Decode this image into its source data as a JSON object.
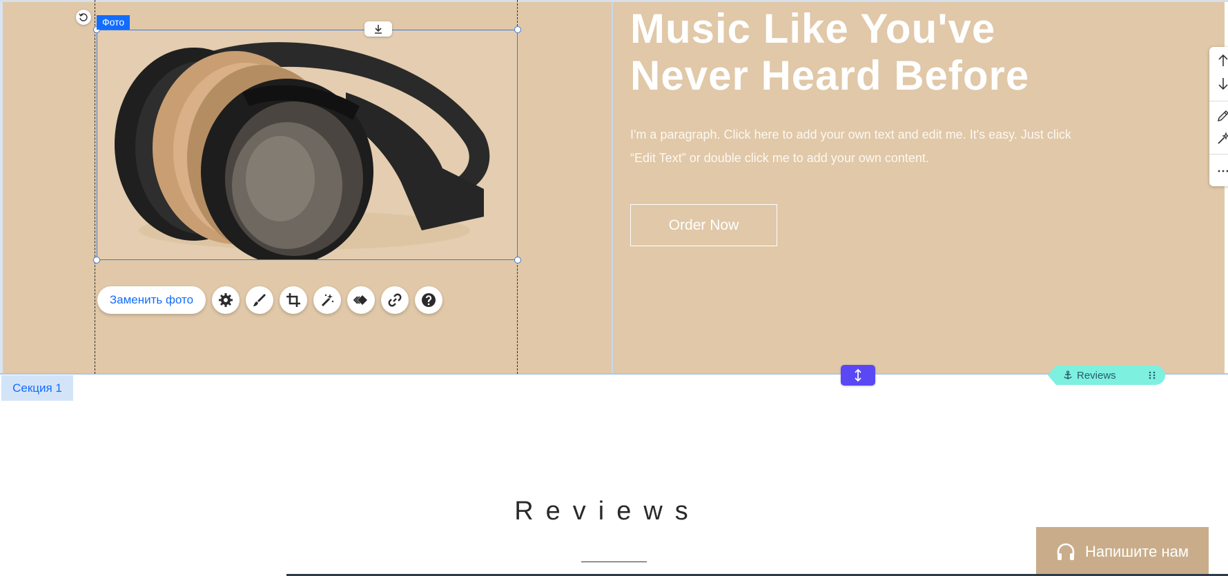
{
  "editor": {
    "photo_label": "Фото",
    "replace_photo_label": "Заменить фото",
    "section_label": "Секция 1",
    "anchor_label": "Reviews"
  },
  "hero": {
    "title": "Music Like You've Never Heard Before",
    "paragraph": "I'm a paragraph. Click here to add your own text and edit me. It's easy. Just click “Edit Text” or double click me to add your own content.",
    "button_label": "Order Now"
  },
  "reviews": {
    "title": "Reviews"
  },
  "chat": {
    "label": "Напишите нам"
  },
  "colors": {
    "hero_bg": "#e0c8a8",
    "editor_accent": "#116dff",
    "resize_handle": "#5a48f5",
    "anchor_tag": "#7df0e0",
    "chat_bg": "#c9ad8a"
  },
  "icons": [
    "rotate-icon",
    "download-icon",
    "settings-gear-icon",
    "brush-icon",
    "crop-icon",
    "magic-wand-icon",
    "animation-icon",
    "link-icon",
    "help-icon",
    "arrow-up-icon",
    "arrow-down-icon",
    "pen-icon",
    "sparkle-wand-icon",
    "more-icon",
    "vertical-resize-icon",
    "anchor-icon",
    "drag-grip-icon",
    "headphones-icon"
  ]
}
